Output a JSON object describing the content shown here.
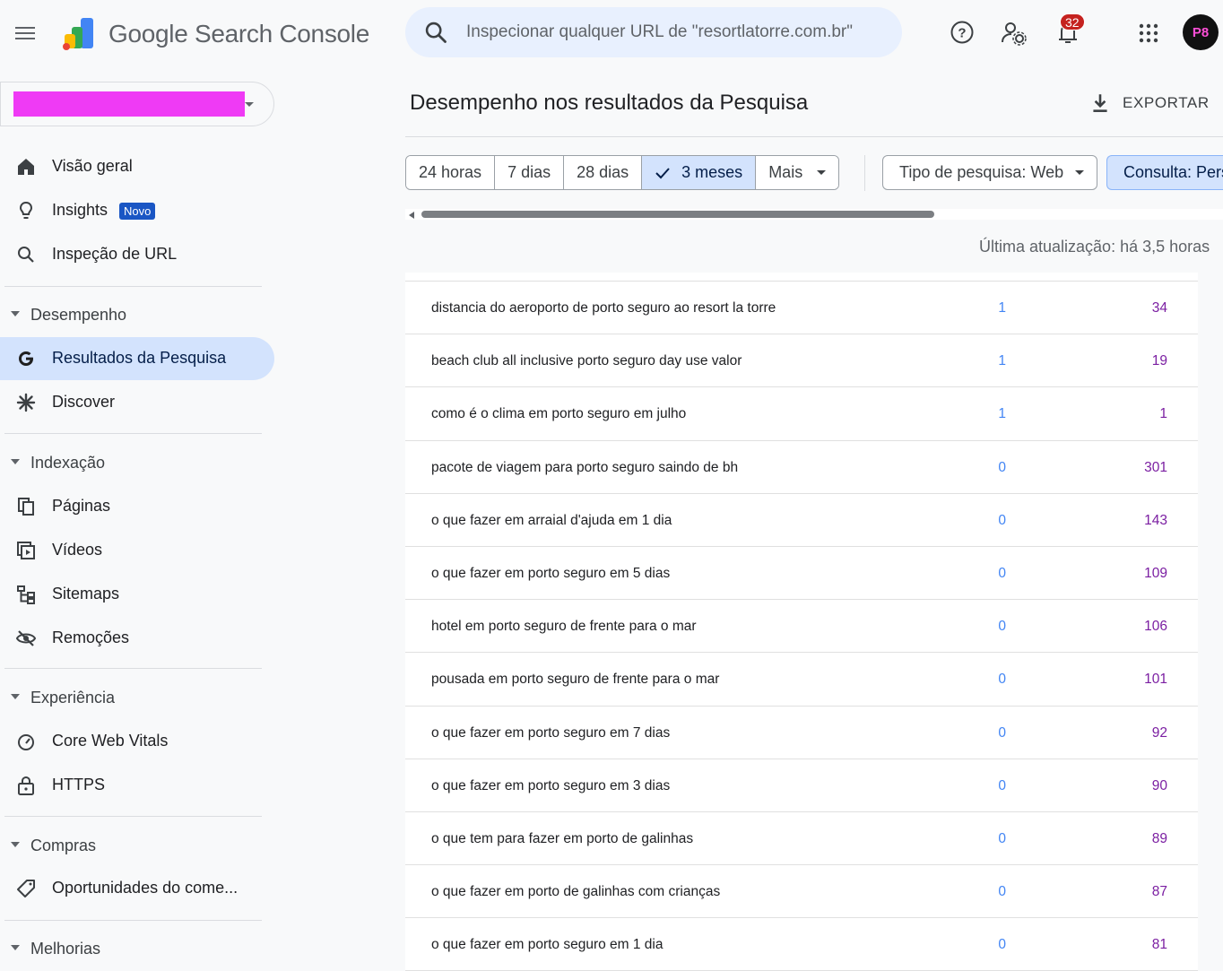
{
  "app": {
    "name": "Google Search Console",
    "search_placeholder": "Inspecionar qualquer URL de \"resortlatorre.com.br\"",
    "notifications_count": "32",
    "avatar_text": "P8"
  },
  "sidebar": {
    "top_items": [
      {
        "label": "Visão geral",
        "icon": "home-icon"
      },
      {
        "label": "Insights",
        "icon": "lightbulb-icon",
        "badge": "Novo"
      },
      {
        "label": "Inspeção de URL",
        "icon": "search-icon"
      }
    ],
    "sections": [
      {
        "label": "Desempenho",
        "items": [
          {
            "label": "Resultados da Pesquisa",
            "icon": "google-g-icon",
            "active": true
          },
          {
            "label": "Discover",
            "icon": "asterisk-icon"
          }
        ]
      },
      {
        "label": "Indexação",
        "items": [
          {
            "label": "Páginas",
            "icon": "pages-icon"
          },
          {
            "label": "Vídeos",
            "icon": "video-icon"
          },
          {
            "label": "Sitemaps",
            "icon": "sitemap-icon"
          },
          {
            "label": "Remoções",
            "icon": "eye-off-icon"
          }
        ]
      },
      {
        "label": "Experiência",
        "items": [
          {
            "label": "Core Web Vitals",
            "icon": "gauge-icon"
          },
          {
            "label": "HTTPS",
            "icon": "lock-icon"
          }
        ]
      },
      {
        "label": "Compras",
        "items": [
          {
            "label": "Oportunidades do come...",
            "icon": "tag-icon"
          }
        ]
      },
      {
        "label": "Melhorias",
        "items": []
      }
    ]
  },
  "main": {
    "title": "Desempenho nos resultados da Pesquisa",
    "export_label": "EXPORTAR",
    "date_chips": [
      "24 horas",
      "7 dias",
      "28 dias",
      "3 meses",
      "Mais"
    ],
    "selected_chip": "3 meses",
    "filter_type": "Tipo de pesquisa: Web",
    "filter_query": "Consulta: Personalizado",
    "last_updated": "Última atualização: há 3,5 horas"
  },
  "table": {
    "rows": [
      {
        "query": "distancia do aeroporto de porto seguro ao resort la torre",
        "clicks": "1",
        "impressions": "34"
      },
      {
        "query": "beach club all inclusive porto seguro day use valor",
        "clicks": "1",
        "impressions": "19"
      },
      {
        "query": "como é o clima em porto seguro em julho",
        "clicks": "1",
        "impressions": "1"
      },
      {
        "query": "pacote de viagem para porto seguro saindo de bh",
        "clicks": "0",
        "impressions": "301"
      },
      {
        "query": "o que fazer em arraial d'ajuda em 1 dia",
        "clicks": "0",
        "impressions": "143"
      },
      {
        "query": "o que fazer em porto seguro em 5 dias",
        "clicks": "0",
        "impressions": "109"
      },
      {
        "query": "hotel em porto seguro de frente para o mar",
        "clicks": "0",
        "impressions": "106"
      },
      {
        "query": "pousada em porto seguro de frente para o mar",
        "clicks": "0",
        "impressions": "101"
      },
      {
        "query": "o que fazer em porto seguro em 7 dias",
        "clicks": "0",
        "impressions": "92"
      },
      {
        "query": "o que fazer em porto seguro em 3 dias",
        "clicks": "0",
        "impressions": "90"
      },
      {
        "query": "o que tem para fazer em porto de galinhas",
        "clicks": "0",
        "impressions": "89"
      },
      {
        "query": "o que fazer em porto de galinhas com crianças",
        "clicks": "0",
        "impressions": "87"
      },
      {
        "query": "o que fazer em porto seguro em 1 dia",
        "clicks": "0",
        "impressions": "81"
      }
    ]
  },
  "colors": {
    "accent": "#d3e3fd",
    "clicks": "#4285f4",
    "impressions": "#7b1fa2",
    "badge": "#c5221f"
  }
}
